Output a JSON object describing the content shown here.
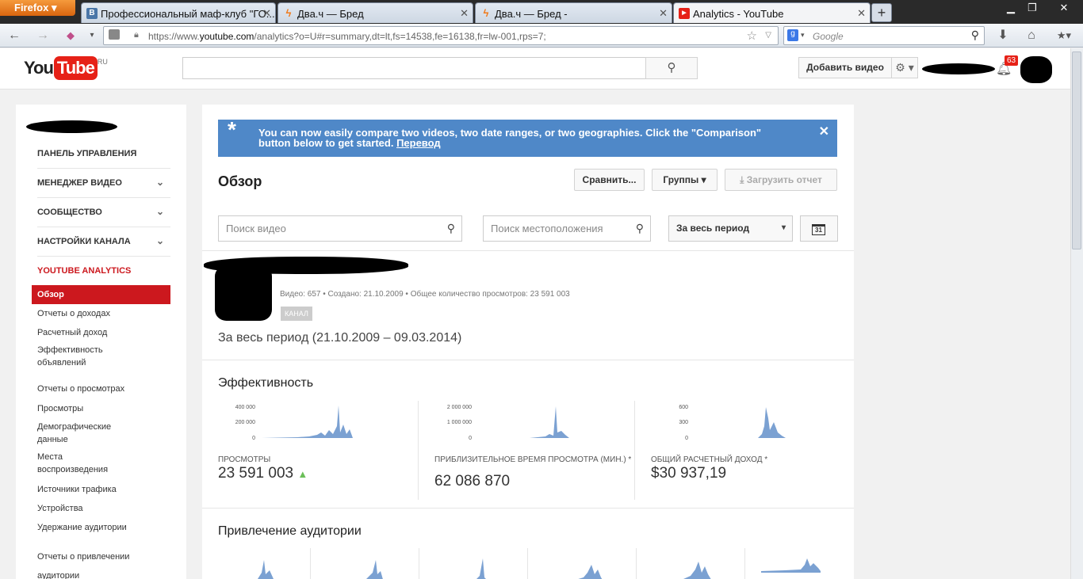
{
  "browser": {
    "firefox_label": "Firefox",
    "tabs": [
      {
        "title": "Профессиональный маф-клуб \"ГО...",
        "favicon": "vk-icon",
        "color": "#4a76a8"
      },
      {
        "title": "Два.ч — Бред",
        "favicon": "lightning-icon",
        "color": "#f07a1a"
      },
      {
        "title": "Два.ч — Бред -",
        "favicon": "lightning-icon",
        "color": "#f07a1a"
      },
      {
        "title": "Analytics - YouTube",
        "favicon": "youtube-icon",
        "color": "#e62117"
      }
    ],
    "url_prefix": "https://www.",
    "url_domain": "youtube.com",
    "url_rest": "/analytics?o=U#r=summary,dt=lt,fs=14538,fe=16138,fr=lw-001,rps=7;",
    "search_engine_placeholder": "Google"
  },
  "yt_header": {
    "logo_you": "You",
    "logo_tube": "Tube",
    "logo_region": "RU",
    "upload_button": "Добавить видео",
    "notification_count": "63"
  },
  "sidebar": {
    "sections": [
      {
        "label": "ПАНЕЛЬ УПРАВЛЕНИЯ"
      },
      {
        "label": "МЕНЕДЖЕР ВИДЕО"
      },
      {
        "label": "СООБЩЕСТВО"
      },
      {
        "label": "НАСТРОЙКИ КАНАЛА"
      },
      {
        "label": "YOUTUBE ANALYTICS"
      }
    ],
    "active_item": "Обзор",
    "revenue_items": [
      "Отчеты о доходах",
      "Расчетный доход",
      "Эффективность объявлений"
    ],
    "views_group": "Отчеты о просмотрах",
    "views_items": [
      "Просмотры",
      "Демографические данные",
      "Места воспроизведения",
      "Источники трафика",
      "Устройства",
      "Удержание аудитории"
    ],
    "engagement_group": "Отчеты о привлечении аудитории"
  },
  "banner": {
    "text": "You can now easily compare two videos, two date ranges, or two geographies. Click the \"Comparison\" button below to get started.",
    "link": "Перевод"
  },
  "main": {
    "title": "Обзор",
    "compare_button": "Сравнить...",
    "groups_button": "Группы",
    "download_button": "Загрузить отчет",
    "video_search_placeholder": "Поиск видео",
    "location_search_placeholder": "Поиск местоположения",
    "period_select": "За весь период",
    "calendar_day": "31",
    "channel_meta": "Видео: 657  •  Создано: 21.10.2009  •  Общее количество просмотров: 23 591 003",
    "channel_badge": "КАНАЛ",
    "period_text": "За весь период (21.10.2009 – 09.03.2014)",
    "performance_title": "Эффективность",
    "engagement_title": "Привлечение аудитории"
  },
  "metrics": [
    {
      "label": "ПРОСМОТРЫ",
      "value": "23 591 003",
      "trend": "▲",
      "yticks": [
        "400 000",
        "200 000",
        "0"
      ],
      "color": "#7ba1d2"
    },
    {
      "label": "ПРИБЛИЗИТЕЛЬНОЕ ВРЕМЯ ПРОСМОТРА (МИН.) *",
      "value": "62 086 870",
      "yticks": [
        "2 000 000",
        "1 000 000",
        "0"
      ],
      "color": "#7ba1d2"
    },
    {
      "label": "ОБЩИЙ РАСЧЕТНЫЙ ДОХОД *",
      "value": "$30 937,19",
      "yticks": [
        "600",
        "300",
        "0"
      ],
      "color": "#7ba1d2"
    }
  ]
}
